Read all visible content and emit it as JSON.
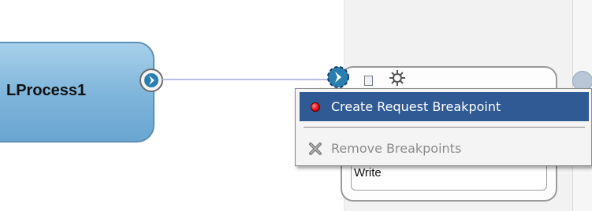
{
  "process": {
    "label": "LProcess1"
  },
  "activity": {
    "label": "Write"
  },
  "context_menu": {
    "items": [
      {
        "label": "Create Request Breakpoint",
        "icon": "red-dot-icon",
        "state": "selected"
      },
      {
        "label": "Remove Breakpoints",
        "icon": "remove-x-icon",
        "state": "disabled"
      }
    ]
  },
  "colors": {
    "process_fill": "#7db4da",
    "menu_highlight": "#2f5a93",
    "wire": "#b8bce6",
    "breakpoint_dot": "#e01010"
  }
}
